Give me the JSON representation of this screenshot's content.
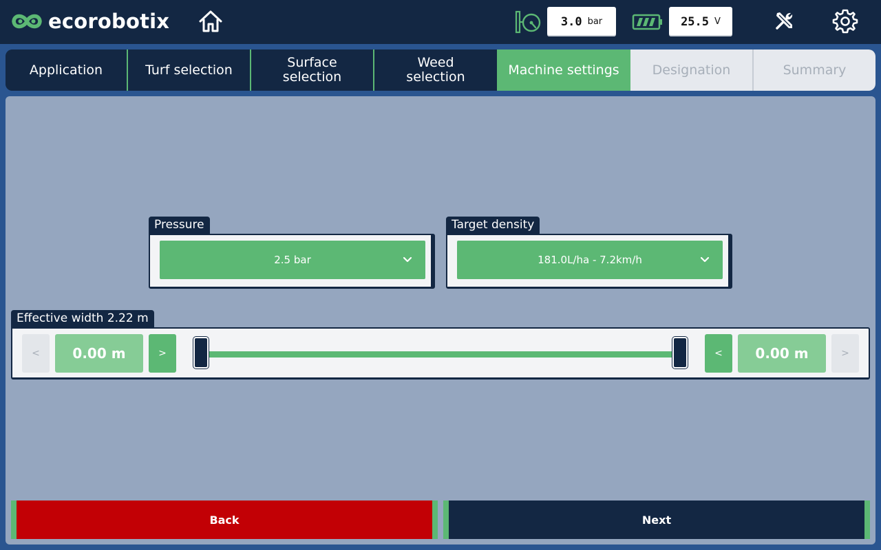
{
  "app": {
    "brand": "ecorobotix"
  },
  "header": {
    "pressure_value": "3.0",
    "pressure_unit": "bar",
    "voltage_value": "25.5",
    "voltage_unit": "V",
    "battery_level": 1.0,
    "icons": [
      "logo-icon",
      "home-icon",
      "pressure-gauge-icon",
      "battery-icon",
      "tools-icon",
      "gear-icon"
    ]
  },
  "tabs": [
    {
      "label": "Application",
      "state": "done"
    },
    {
      "label": "Turf selection",
      "state": "done"
    },
    {
      "label": "Surface selection",
      "state": "done"
    },
    {
      "label": "Weed selection",
      "state": "done"
    },
    {
      "label": "Machine settings",
      "state": "active"
    },
    {
      "label": "Designation",
      "state": "disabled"
    },
    {
      "label": "Summary",
      "state": "disabled"
    }
  ],
  "form": {
    "pressure": {
      "label": "Pressure",
      "selected": "2.5 bar"
    },
    "target_density": {
      "label": "Target density",
      "selected": "181.0L/ha - 7.2km/h"
    },
    "effective_width": {
      "label": "Effective width 2.22 m",
      "left_value": "0.00 m",
      "right_value": "0.00 m",
      "left_decrease": "<",
      "left_increase": ">",
      "right_decrease": "<",
      "right_increase": ">"
    }
  },
  "actions": {
    "back_label": "Back",
    "next_label": "Next"
  },
  "colors": {
    "navy": "#132743",
    "green": "#5cb874",
    "panel": "#95a6bf",
    "back_red": "#c20005",
    "background_blue": "#2a5590"
  }
}
